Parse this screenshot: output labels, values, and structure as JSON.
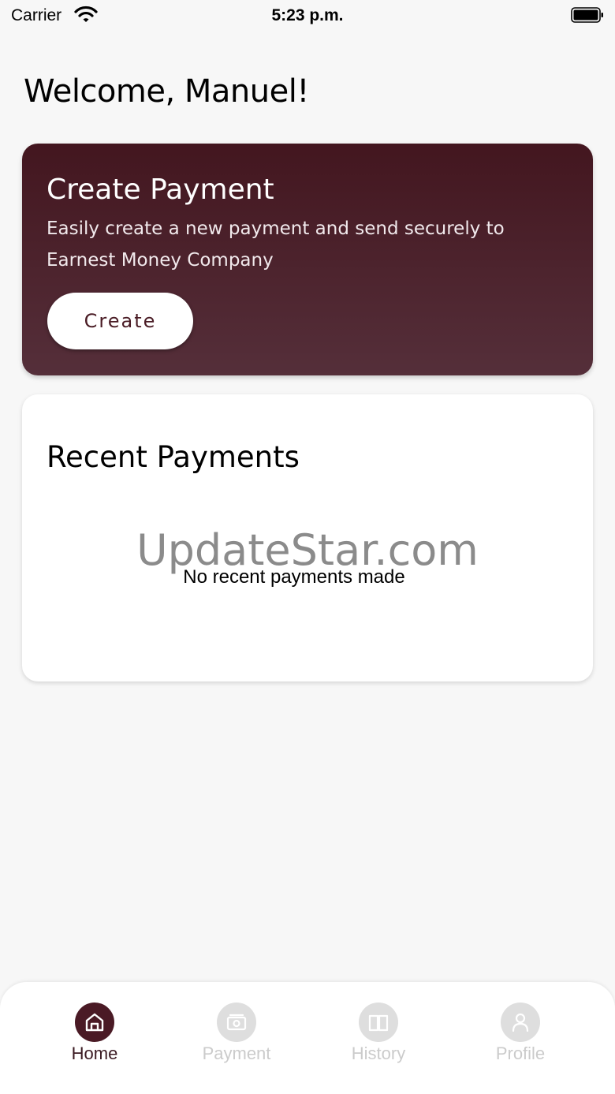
{
  "status_bar": {
    "carrier": "Carrier",
    "time": "5:23 p.m."
  },
  "welcome": "Welcome, Manuel!",
  "create_card": {
    "title": "Create Payment",
    "description": "Easily create a new payment and send securely to Earnest Money Company",
    "button_label": "Create"
  },
  "recent_card": {
    "title": "Recent Payments",
    "watermark": "UpdateStar.com",
    "empty_message": "No recent payments made"
  },
  "bottom_nav": {
    "items": [
      {
        "label": "Home",
        "icon": "home-icon",
        "active": true
      },
      {
        "label": "Payment",
        "icon": "payment-icon",
        "active": false
      },
      {
        "label": "History",
        "icon": "book-icon",
        "active": false
      },
      {
        "label": "Profile",
        "icon": "profile-icon",
        "active": false
      }
    ]
  },
  "colors": {
    "card_gradient_top": "#43161f",
    "card_gradient_bottom": "#552f3a",
    "nav_active": "#4a1a25",
    "nav_inactive": "#dedede",
    "background": "#f7f7f7"
  }
}
